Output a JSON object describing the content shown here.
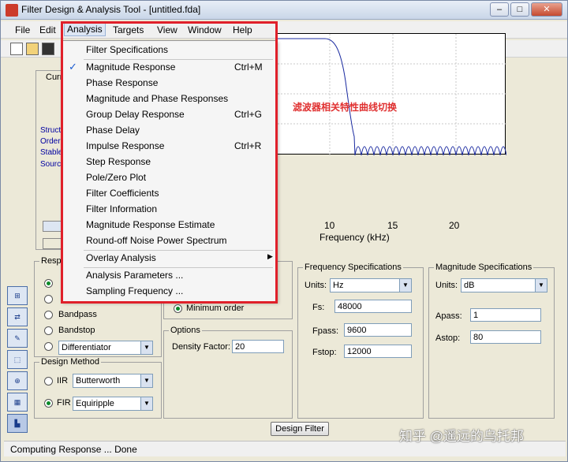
{
  "window": {
    "title": "Filter Design & Analysis Tool - [untitled.fda]"
  },
  "menubar": [
    "File",
    "Edit",
    "Analysis",
    "Targets",
    "View",
    "Window",
    "Help"
  ],
  "analysis_menu": {
    "items": [
      {
        "label": "Filter Specifications",
        "shortcut": ""
      },
      {
        "label": "Magnitude Response",
        "shortcut": "Ctrl+M",
        "checked": true
      },
      {
        "label": "Phase Response",
        "shortcut": ""
      },
      {
        "label": "Magnitude and Phase Responses",
        "shortcut": ""
      },
      {
        "label": "Group Delay Response",
        "shortcut": "Ctrl+G"
      },
      {
        "label": "Phase Delay",
        "shortcut": ""
      },
      {
        "label": "Impulse Response",
        "shortcut": "Ctrl+R"
      },
      {
        "label": "Step Response",
        "shortcut": ""
      },
      {
        "label": "Pole/Zero Plot",
        "shortcut": ""
      },
      {
        "label": "Filter Coefficients",
        "shortcut": ""
      },
      {
        "label": "Filter Information",
        "shortcut": ""
      },
      {
        "label": "Magnitude Response Estimate",
        "shortcut": ""
      },
      {
        "label": "Round-off Noise Power Spectrum",
        "shortcut": ""
      },
      {
        "label": "Overlay Analysis",
        "shortcut": ""
      },
      {
        "label": "Analysis Parameters ...",
        "shortcut": ""
      },
      {
        "label": "Sampling Frequency ...",
        "shortcut": ""
      }
    ]
  },
  "current_filter": {
    "section_label": "Curre",
    "fields": [
      "Structu",
      "Order:",
      "Stable:",
      "Source"
    ]
  },
  "plot": {
    "annotation": "滤波器相关特性曲线切换",
    "xlabel": "Frequency (kHz)",
    "ticks": [
      "10",
      "15",
      "20"
    ]
  },
  "response_type": {
    "title": "Resp",
    "options": [
      "Bandpass",
      "Bandstop"
    ],
    "differentiator": "Differentiator"
  },
  "design_method": {
    "title": "Design Method",
    "iir_label": "IIR",
    "iir_value": "Butterworth",
    "fir_label": "FIR",
    "fir_value": "Equiripple"
  },
  "filter_order": {
    "minimum_order": "Minimum order"
  },
  "options": {
    "title": "Options",
    "density_label": "Density Factor:",
    "density_value": "20"
  },
  "frequency_specs": {
    "title": "Frequency Specifications",
    "units_label": "Units:",
    "units_value": "Hz",
    "fs_label": "Fs:",
    "fs_value": "48000",
    "fpass_label": "Fpass:",
    "fpass_value": "9600",
    "fstop_label": "Fstop:",
    "fstop_value": "12000"
  },
  "magnitude_specs": {
    "title": "Magnitude Specifications",
    "units_label": "Units:",
    "units_value": "dB",
    "apass_label": "Apass:",
    "apass_value": "1",
    "astop_label": "Astop:",
    "astop_value": "80"
  },
  "design_button": "Design Filter",
  "status": "Computing Response ... Done",
  "watermark": "知乎 @遥远的乌托邦",
  "colors": {
    "highlight": "#e0202a",
    "plot_line": "#1a2aa0"
  }
}
